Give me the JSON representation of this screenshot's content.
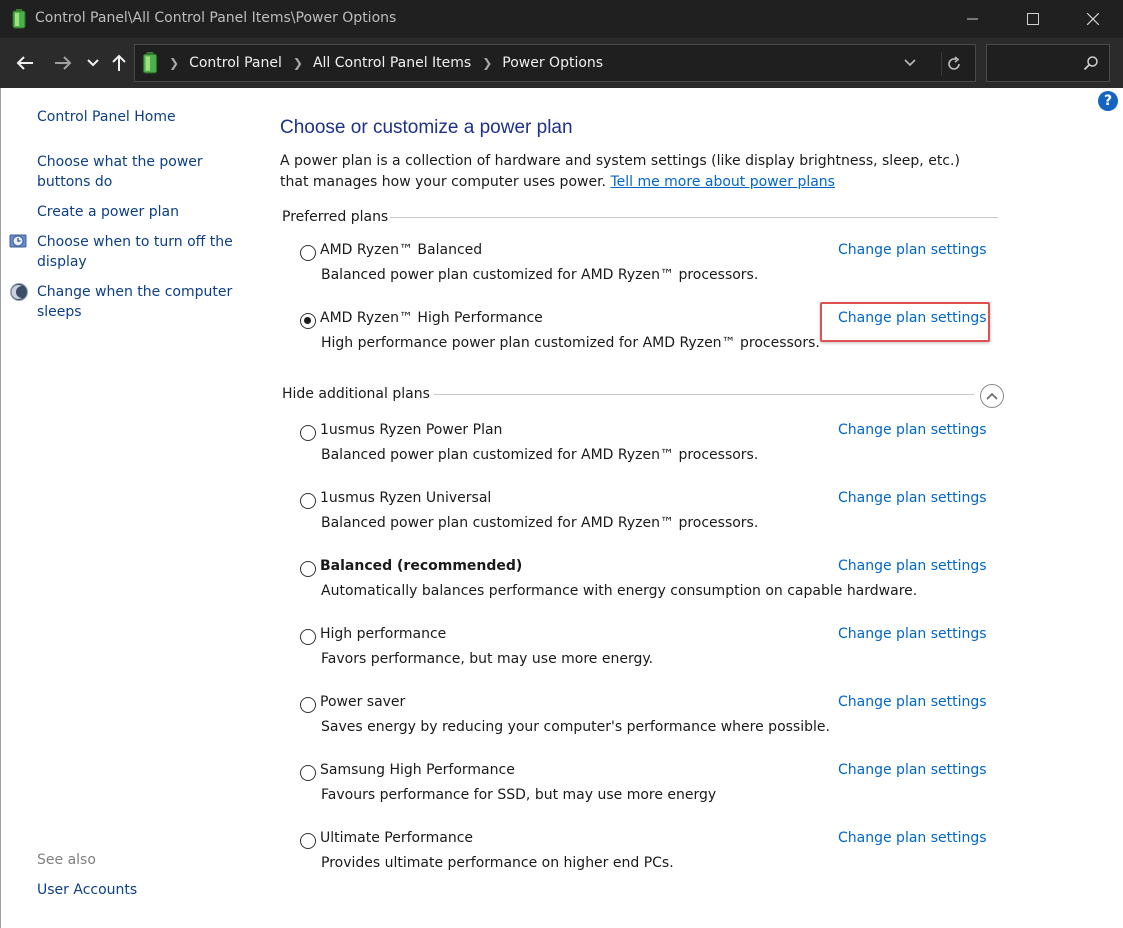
{
  "window": {
    "title": "Control Panel\\All Control Panel Items\\Power Options"
  },
  "address": {
    "crumbs": [
      "Control Panel",
      "All Control Panel Items",
      "Power Options"
    ],
    "search_placeholder": ""
  },
  "sidebar": {
    "home": "Control Panel Home",
    "links": [
      "Choose what the power buttons do",
      "Create a power plan",
      "Choose when to turn off the display",
      "Change when the computer sleeps"
    ],
    "see_also": "See also",
    "user_accounts": "User Accounts"
  },
  "main": {
    "title": "Choose or customize a power plan",
    "intro": "A power plan is a collection of hardware and system settings (like display brightness, sleep, etc.) that manages how your computer uses power.",
    "intro_link": "Tell me more about power plans",
    "preferred_header": "Preferred plans",
    "additional_header": "Hide additional plans",
    "change_label": "Change plan settings",
    "preferred_plans": [
      {
        "name": "AMD Ryzen™ Balanced",
        "desc": "Balanced power plan customized for AMD Ryzen™ processors.",
        "selected": false,
        "bold": false
      },
      {
        "name": "AMD Ryzen™ High Performance",
        "desc": "High performance power plan customized for AMD Ryzen™ processors.",
        "selected": true,
        "bold": false
      }
    ],
    "additional_plans": [
      {
        "name": "1usmus Ryzen Power Plan",
        "desc": "Balanced power plan customized for AMD Ryzen™ processors.",
        "selected": false,
        "bold": false
      },
      {
        "name": "1usmus Ryzen Universal",
        "desc": "Balanced power plan customized for AMD Ryzen™ processors.",
        "selected": false,
        "bold": false
      },
      {
        "name": "Balanced (recommended)",
        "desc": "Automatically balances performance with energy consumption on capable hardware.",
        "selected": false,
        "bold": true
      },
      {
        "name": "High performance",
        "desc": "Favors performance, but may use more energy.",
        "selected": false,
        "bold": false
      },
      {
        "name": "Power saver",
        "desc": "Saves energy by reducing your computer's performance where possible.",
        "selected": false,
        "bold": false
      },
      {
        "name": "Samsung High Performance",
        "desc": "Favours performance for SSD, but may use more energy",
        "selected": false,
        "bold": false
      },
      {
        "name": "Ultimate Performance",
        "desc": "Provides ultimate performance on higher end PCs.",
        "selected": false,
        "bold": false
      }
    ]
  },
  "colors": {
    "link": "#0066cc",
    "title": "#1e3287",
    "highlight": "#e05050"
  }
}
